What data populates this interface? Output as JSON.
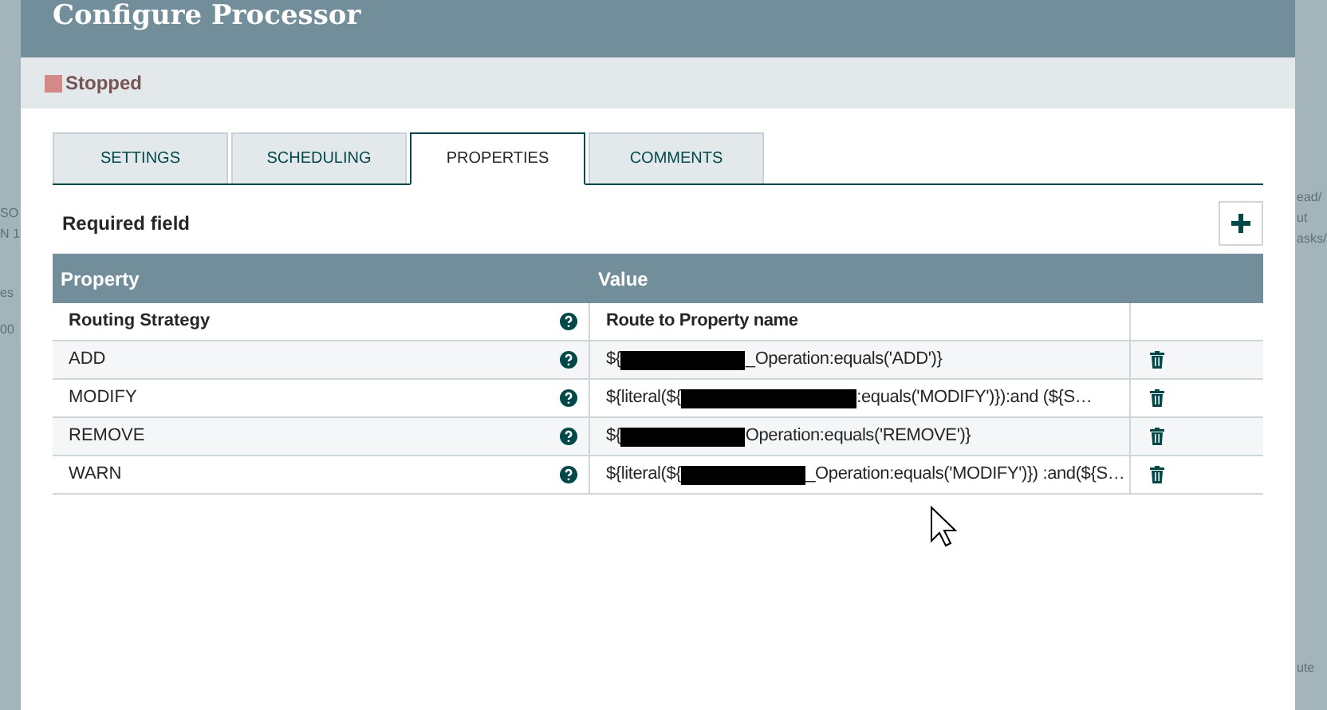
{
  "backdrop": {
    "left_texts": [
      "SO",
      "N 1",
      "es",
      "00"
    ],
    "right_texts": [
      "ead/",
      "ut",
      "asks/",
      "ute"
    ]
  },
  "dialog": {
    "title": "Configure Processor",
    "status": {
      "label": "Stopped",
      "color": "#d48888"
    }
  },
  "tabs": [
    {
      "label": "SETTINGS",
      "selected": false
    },
    {
      "label": "SCHEDULING",
      "selected": false
    },
    {
      "label": "PROPERTIES",
      "selected": true
    },
    {
      "label": "COMMENTS",
      "selected": false
    }
  ],
  "required_label": "Required field",
  "table": {
    "columns": [
      "Property",
      "Value"
    ],
    "rows": [
      {
        "property": "Routing Strategy",
        "required": true,
        "value": [
          "Route to Property name"
        ],
        "deletable": false
      },
      {
        "property": "ADD",
        "required": false,
        "value": [
          "${",
          "_Operation:equals('ADD')}"
        ],
        "deletable": true
      },
      {
        "property": "MODIFY",
        "required": false,
        "value": [
          "${literal(${",
          ":equals('MODIFY')}):and (${S…"
        ],
        "deletable": true
      },
      {
        "property": "REMOVE",
        "required": false,
        "value": [
          "${",
          "Operation:equals('REMOVE')}"
        ],
        "deletable": true
      },
      {
        "property": "WARN",
        "required": false,
        "value": [
          "${literal(${",
          "_Operation:equals('MODIFY')}) :and(${S…"
        ],
        "deletable": true
      }
    ]
  }
}
